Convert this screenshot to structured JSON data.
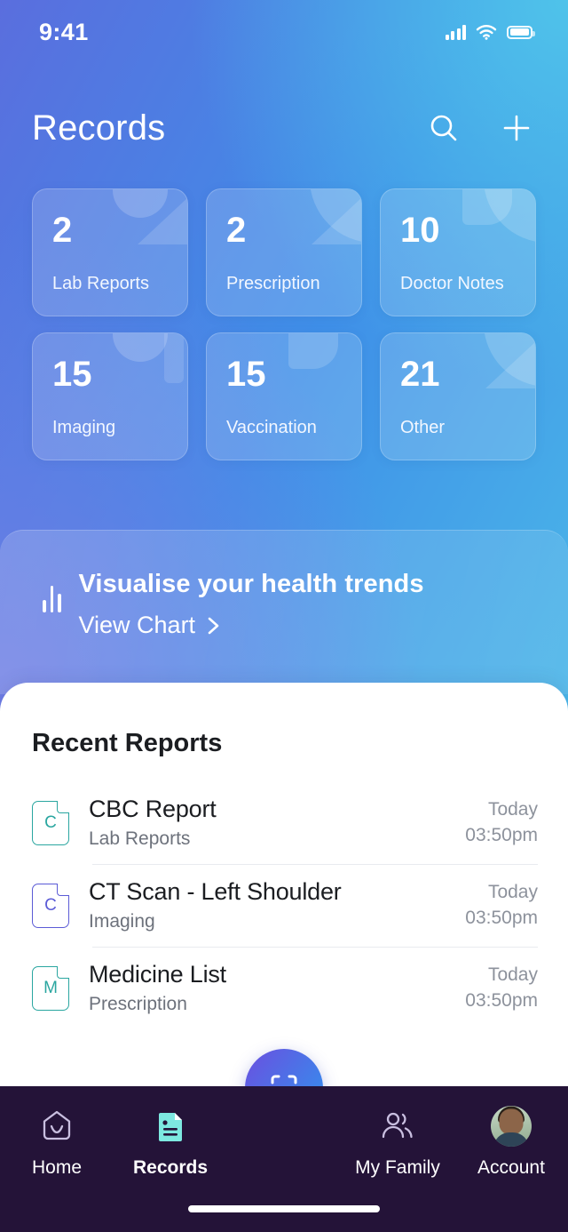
{
  "status_bar": {
    "time": "9:41",
    "cellular_icon": "cellular-signal-icon",
    "wifi_icon": "wifi-icon",
    "battery_icon": "battery-icon"
  },
  "header": {
    "title": "Records",
    "search_icon": "search-icon",
    "add_icon": "plus-icon"
  },
  "stats": [
    {
      "value": "2",
      "label": "Lab Reports"
    },
    {
      "value": "2",
      "label": "Prescription"
    },
    {
      "value": "10",
      "label": "Doctor Notes"
    },
    {
      "value": "15",
      "label": "Imaging"
    },
    {
      "value": "15",
      "label": "Vaccination"
    },
    {
      "value": "21",
      "label": "Other"
    }
  ],
  "trends": {
    "icon": "bar-chart-icon",
    "title": "Visualise your health trends",
    "link_label": "View Chart",
    "chevron_icon": "chevron-right-icon"
  },
  "recent": {
    "title": "Recent Reports",
    "items": [
      {
        "letter": "C",
        "title": "CBC Report",
        "category": "Lab Reports",
        "day": "Today",
        "time": "03:50pm",
        "color": "#2aa6a0"
      },
      {
        "letter": "C",
        "title": "CT Scan - Left Shoulder",
        "category": "Imaging",
        "day": "Today",
        "time": "03:50pm",
        "color": "#5b5bd6"
      },
      {
        "letter": "M",
        "title": "Medicine List",
        "category": "Prescription",
        "day": "Today",
        "time": "03:50pm",
        "color": "#2aa6a0"
      }
    ]
  },
  "fab": {
    "icon": "scan-icon",
    "label": "Scan"
  },
  "nav": {
    "items": [
      {
        "label": "Home",
        "icon": "home-icon",
        "active": false
      },
      {
        "label": "Records",
        "icon": "document-icon",
        "active": true
      },
      {
        "label": "My Family",
        "icon": "people-icon",
        "active": false
      },
      {
        "label": "Account",
        "icon": "avatar-icon",
        "active": false
      }
    ]
  },
  "colors": {
    "gradient_start": "#5a6ede",
    "gradient_end": "#4ab6e8",
    "nav_background": "#241338",
    "active_nav": "#7de8e0",
    "fab_start": "#6b4fe0",
    "fab_end": "#2f95ef"
  }
}
